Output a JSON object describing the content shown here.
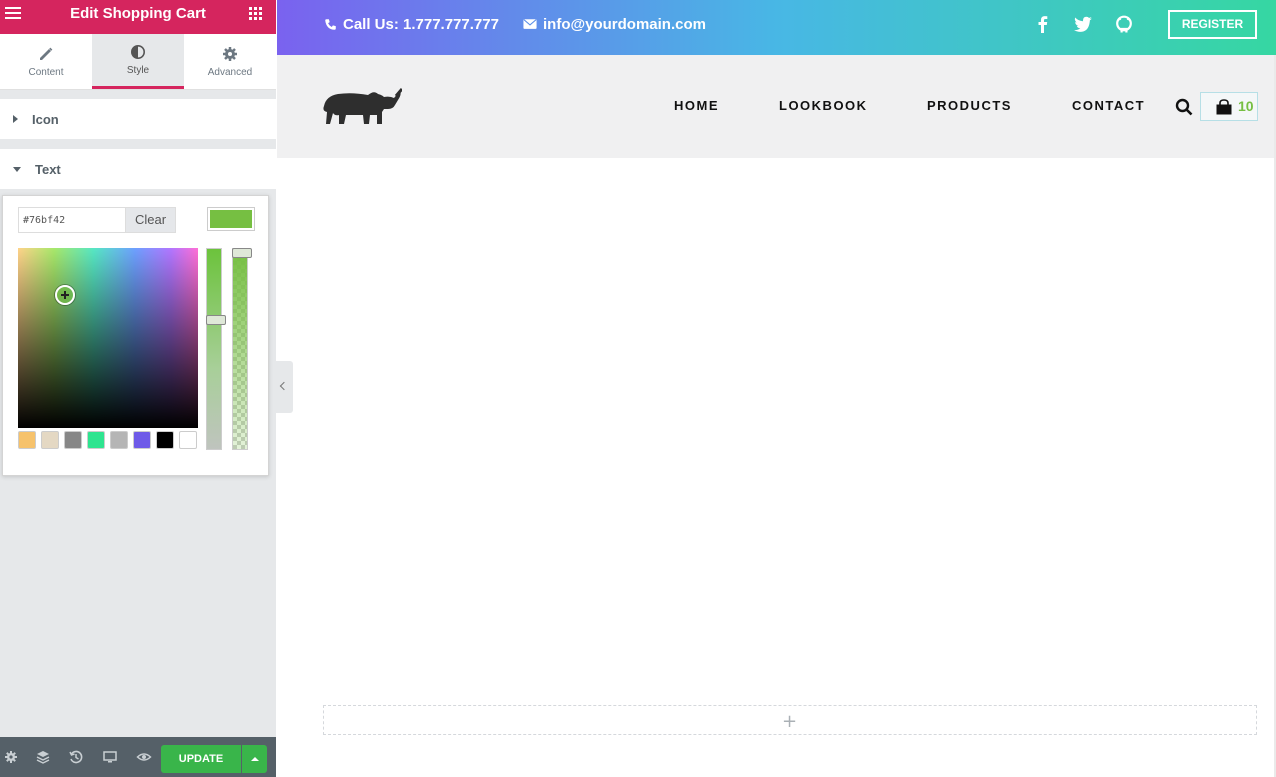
{
  "panel": {
    "title": "Edit Shopping Cart",
    "tabs": [
      {
        "label": "Content",
        "icon": "pencil-icon"
      },
      {
        "label": "Style",
        "icon": "half-circle-icon"
      },
      {
        "label": "Advanced",
        "icon": "gear-icon"
      }
    ],
    "active_tab": "Style",
    "sections": [
      {
        "label": "Icon",
        "state": "collapsed"
      },
      {
        "label": "Text",
        "state": "expanded"
      }
    ],
    "color_picker": {
      "hex_value": "#76bf42",
      "clear_label": "Clear",
      "selected_color": "#76bf42",
      "presets": [
        "#f6c26b",
        "#e4d8c3",
        "#878787",
        "#2ee48f",
        "#b5b5b5",
        "#6e5ae8",
        "#000000",
        "#ffffff"
      ]
    },
    "footer": {
      "icons": [
        "gear-icon",
        "layers-icon",
        "history-icon",
        "desktop-icon",
        "eye-icon"
      ],
      "update_label": "UPDATE"
    }
  },
  "site": {
    "topbar": {
      "phone": "Call Us: 1.777.777.777",
      "email": "info@yourdomain.com",
      "social": [
        "facebook-icon",
        "twitter-icon",
        "github-icon"
      ],
      "register_label": "REGISTER"
    },
    "nav": {
      "links": [
        "HOME",
        "LOOKBOOK",
        "PRODUCTS",
        "CONTACT"
      ],
      "cart_count": "10"
    }
  },
  "colors": {
    "brand_pink": "#d5255e",
    "accent_green": "#76bf42",
    "update_green": "#39b54a"
  }
}
